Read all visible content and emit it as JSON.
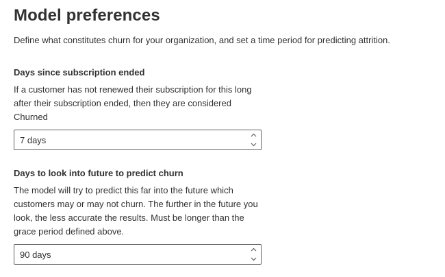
{
  "page": {
    "title": "Model preferences",
    "description": "Define what constitutes churn for your organization, and set a time period for predicting attrition."
  },
  "sections": [
    {
      "heading": "Days since subscription ended",
      "description": "If a customer has not renewed their subscription for this long after their subscription ended, then they are considered Churned",
      "value": "7 days"
    },
    {
      "heading": "Days to look into future to predict churn",
      "description": "The model will try to predict this far into the future which customers may or may not churn. The further in the future you look, the less accurate the results. Must be longer than the grace period defined above.",
      "value": "90 days"
    }
  ],
  "icons": {
    "increment": "chevron-up-icon",
    "decrement": "chevron-down-icon"
  },
  "colors": {
    "text": "#323130",
    "border": "#605e5c"
  }
}
